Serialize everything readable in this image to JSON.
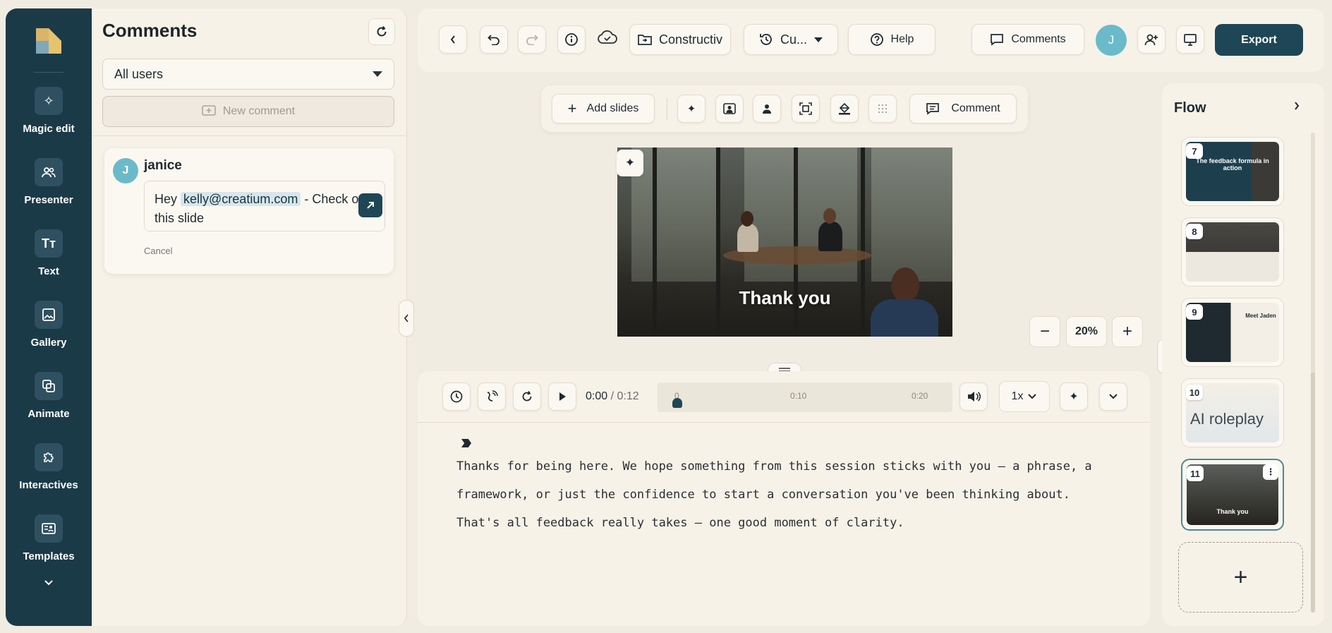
{
  "rail": {
    "items": [
      {
        "label": "Magic edit",
        "icon": "magic-wand-icon",
        "glyph": "✧"
      },
      {
        "label": "Presenter",
        "icon": "presenter-icon",
        "glyph": "👥"
      },
      {
        "label": "Text",
        "icon": "text-icon",
        "glyph": "Tт"
      },
      {
        "label": "Gallery",
        "icon": "gallery-icon",
        "glyph": "▣"
      },
      {
        "label": "Animate",
        "icon": "animate-icon",
        "glyph": "⧉"
      },
      {
        "label": "Interactives",
        "icon": "puzzle-icon",
        "glyph": "✥"
      },
      {
        "label": "Templates",
        "icon": "templates-icon",
        "glyph": "▤"
      }
    ],
    "more": "⌄"
  },
  "comments": {
    "title": "Comments",
    "filter": "All users",
    "new_comment": "New comment",
    "thread": {
      "avatar": "J",
      "author": "janice",
      "text_before": "Hey ",
      "mention": "kelly@creatium.com",
      "text_after": " - Check out this slide",
      "cancel": "Cancel"
    }
  },
  "topbar": {
    "project_name": "Constructiv",
    "version": "Cu...",
    "help": "Help",
    "comments": "Comments",
    "avatar": "J",
    "export": "Export"
  },
  "slidebar": {
    "add_slides": "Add slides",
    "comment": "Comment"
  },
  "slide": {
    "text": "Thank you"
  },
  "zoom": {
    "value": "20%",
    "minus": "−",
    "plus": "+"
  },
  "player": {
    "current": "0:00",
    "separator": " / ",
    "total": "0:12",
    "ticks": [
      "0",
      "0:10",
      "0:20"
    ],
    "speed": "1x"
  },
  "script": {
    "text": "Thanks for being here. We hope something from this session sticks with you — a phrase, a framework, or just the confidence to start a conversation you've been thinking about. That's all feedback really takes — one good moment of clarity."
  },
  "flow": {
    "title": "Flow",
    "slides": [
      {
        "num": "7",
        "caption": "The feedback formula in action"
      },
      {
        "num": "8",
        "caption": ""
      },
      {
        "num": "9",
        "caption": "Meet Jaden"
      },
      {
        "num": "10",
        "caption": "AI roleplay"
      },
      {
        "num": "11",
        "caption": "Thank you"
      }
    ],
    "add": "+"
  },
  "colors": {
    "rail": "#1b3a48",
    "accent": "#1f4656",
    "avatar": "#6bbac9",
    "panel": "#f6f2e8"
  }
}
